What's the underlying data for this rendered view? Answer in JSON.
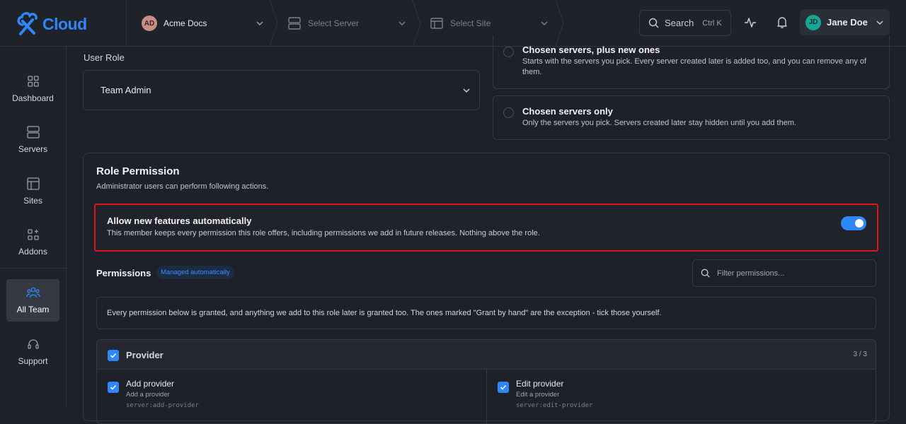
{
  "app": {
    "brand": "Cloud",
    "brand_color": "#2f86f6"
  },
  "breadcrumb": {
    "workspace": {
      "initials": "AD",
      "label": "Acme Docs"
    },
    "server": {
      "placeholder": "Select Server"
    },
    "site": {
      "placeholder": "Select Site"
    }
  },
  "search": {
    "label": "Search",
    "shortcut": "Ctrl K"
  },
  "user": {
    "initials": "JD",
    "name": "Jane Doe"
  },
  "sidebar": {
    "items": [
      {
        "label": "Dashboard",
        "icon": "dashboard-icon"
      },
      {
        "label": "Servers",
        "icon": "server-icon"
      },
      {
        "label": "Sites",
        "icon": "sites-icon"
      },
      {
        "label": "Addons",
        "icon": "addons-icon"
      },
      {
        "label": "All Team",
        "icon": "team-icon",
        "active": true
      },
      {
        "label": "Support",
        "icon": "headset-icon"
      }
    ]
  },
  "form": {
    "user_role_label": "User Role",
    "user_role_value": "Team Admin",
    "server_access": [
      {
        "title": "Chosen servers, plus new ones",
        "description": "Starts with the servers you pick. Every server created later is added too, and you can remove any of them."
      },
      {
        "title": "Chosen servers only",
        "description": "Only the servers you pick. Servers created later stay hidden until you add them."
      }
    ]
  },
  "role_permission": {
    "title": "Role Permission",
    "subtitle": "Administrator users can perform following actions.",
    "auto": {
      "title": "Allow new features automatically",
      "description": "This member keeps every permission this role offers, including permissions we add in future releases. Nothing above the role.",
      "enabled": true
    },
    "permissions_label": "Permissions",
    "managed_badge": "Managed automatically",
    "filter_placeholder": "Filter permissions...",
    "note": "Every permission below is granted, and anything we add to this role later is granted too. The ones marked \"Grant by hand\" are the exception - tick those yourself.",
    "groups": [
      {
        "name": "Provider",
        "count": "3 / 3",
        "items": [
          {
            "title": "Add provider",
            "description": "Add a provider",
            "code": "server:add-provider"
          },
          {
            "title": "Edit provider",
            "description": "Edit a provider",
            "code": "server:edit-provider"
          }
        ]
      }
    ]
  }
}
